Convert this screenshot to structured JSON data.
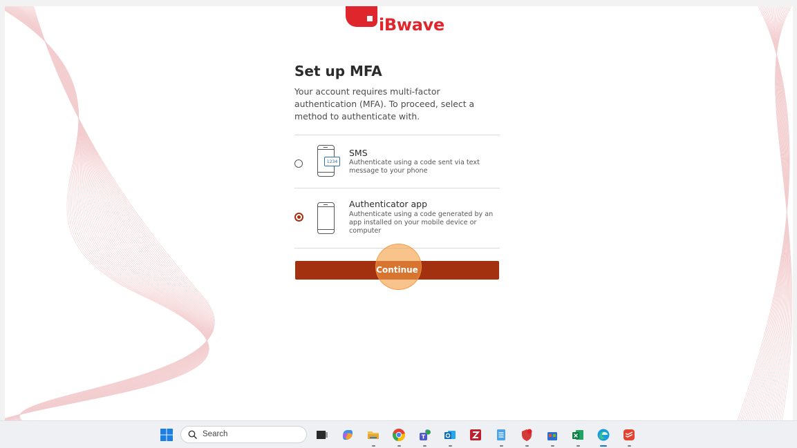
{
  "brand": {
    "logo_text": "iBwave",
    "color": "#e0262d"
  },
  "page": {
    "title": "Set up MFA",
    "description": "Your account requires multi-factor authentication (MFA). To proceed, select a method to authenticate with."
  },
  "options": [
    {
      "title": "SMS",
      "description": "Authenticate using a code sent via text message to your phone",
      "icon": "sms-phone-icon",
      "icon_text": "1234",
      "selected": false
    },
    {
      "title": "Authenticator app",
      "description": "Authenticate using a code generated by an app installed on your mobile device or computer",
      "icon": "mobile-phone-icon",
      "selected": true
    }
  ],
  "actions": {
    "continue_label": "Continue",
    "button_color": "#a3300e"
  },
  "taskbar": {
    "search_placeholder": "Search",
    "apps": [
      "start-icon",
      "task-view-icon",
      "copilot-icon",
      "file-explorer-icon",
      "chrome-icon",
      "teams-icon",
      "outlook-icon",
      "filezilla-icon",
      "notepad-icon",
      "security-icon",
      "store-icon",
      "excel-icon",
      "edge-icon",
      "todoist-icon"
    ]
  }
}
